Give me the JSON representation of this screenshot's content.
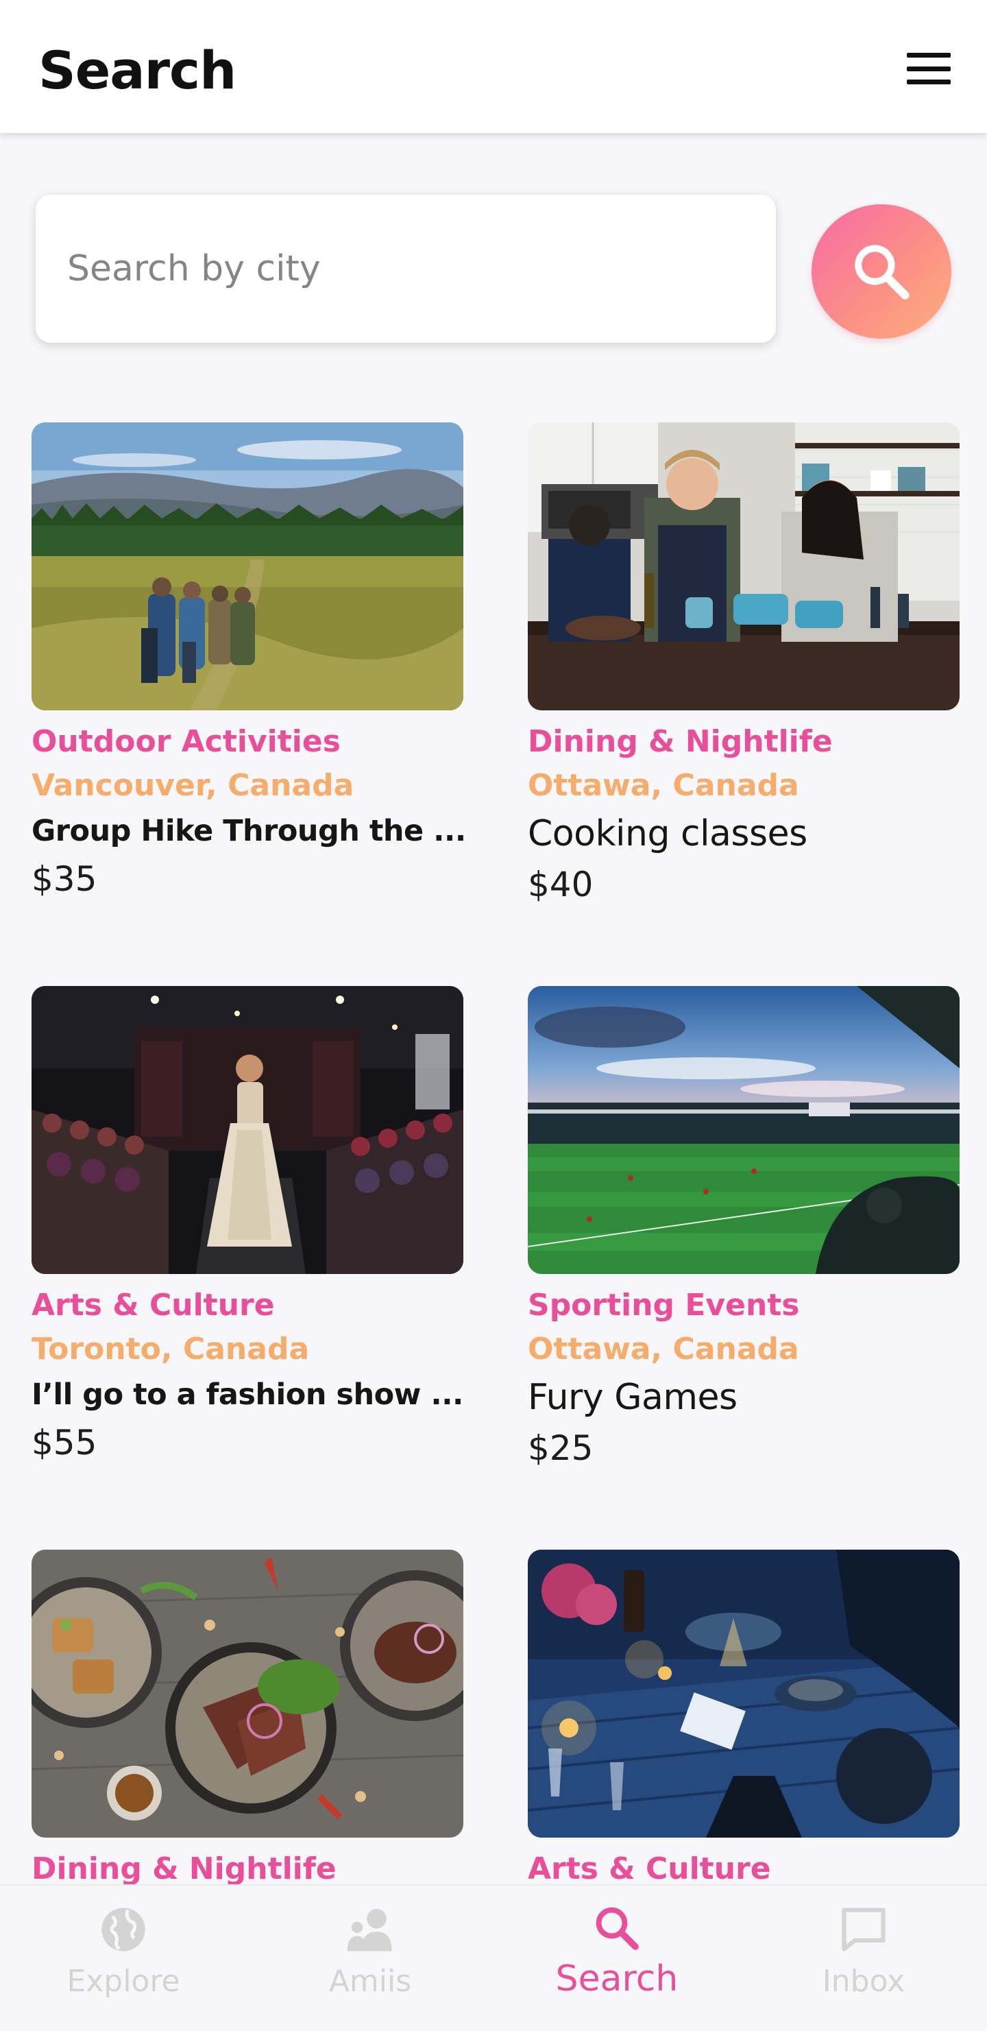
{
  "header": {
    "title": "Search"
  },
  "search": {
    "placeholder": "Search by city",
    "value": ""
  },
  "cards": [
    {
      "category": "Outdoor Activities",
      "location": "Vancouver, Canada",
      "title": "Group Hike Through the ...",
      "price": "$35"
    },
    {
      "category": "Dining & Nightlife",
      "location": "Ottawa, Canada",
      "title": "Cooking classes",
      "price": "$40"
    },
    {
      "category": "Arts & Culture",
      "location": "Toronto, Canada",
      "title": "I’ll go to a fashion show ...",
      "price": "$55"
    },
    {
      "category": "Sporting Events",
      "location": "Ottawa, Canada",
      "title": "Fury Games",
      "price": "$25"
    },
    {
      "category": "Dining & Nightlife"
    },
    {
      "category": "Arts & Culture"
    }
  ],
  "nav": {
    "items": [
      {
        "label": "Explore",
        "icon": "globe-icon"
      },
      {
        "label": "Amiis",
        "icon": "people-icon"
      },
      {
        "label": "Search",
        "icon": "search-icon",
        "active": true
      },
      {
        "label": "Inbox",
        "icon": "chat-bubble-icon"
      }
    ]
  },
  "colors": {
    "accent_pink": "#e94e9a",
    "accent_orange": "#f6ac6a",
    "gradient_start": "#f66aa6",
    "gradient_end": "#fdb07a",
    "inactive_nav": "#d4d4d4"
  }
}
